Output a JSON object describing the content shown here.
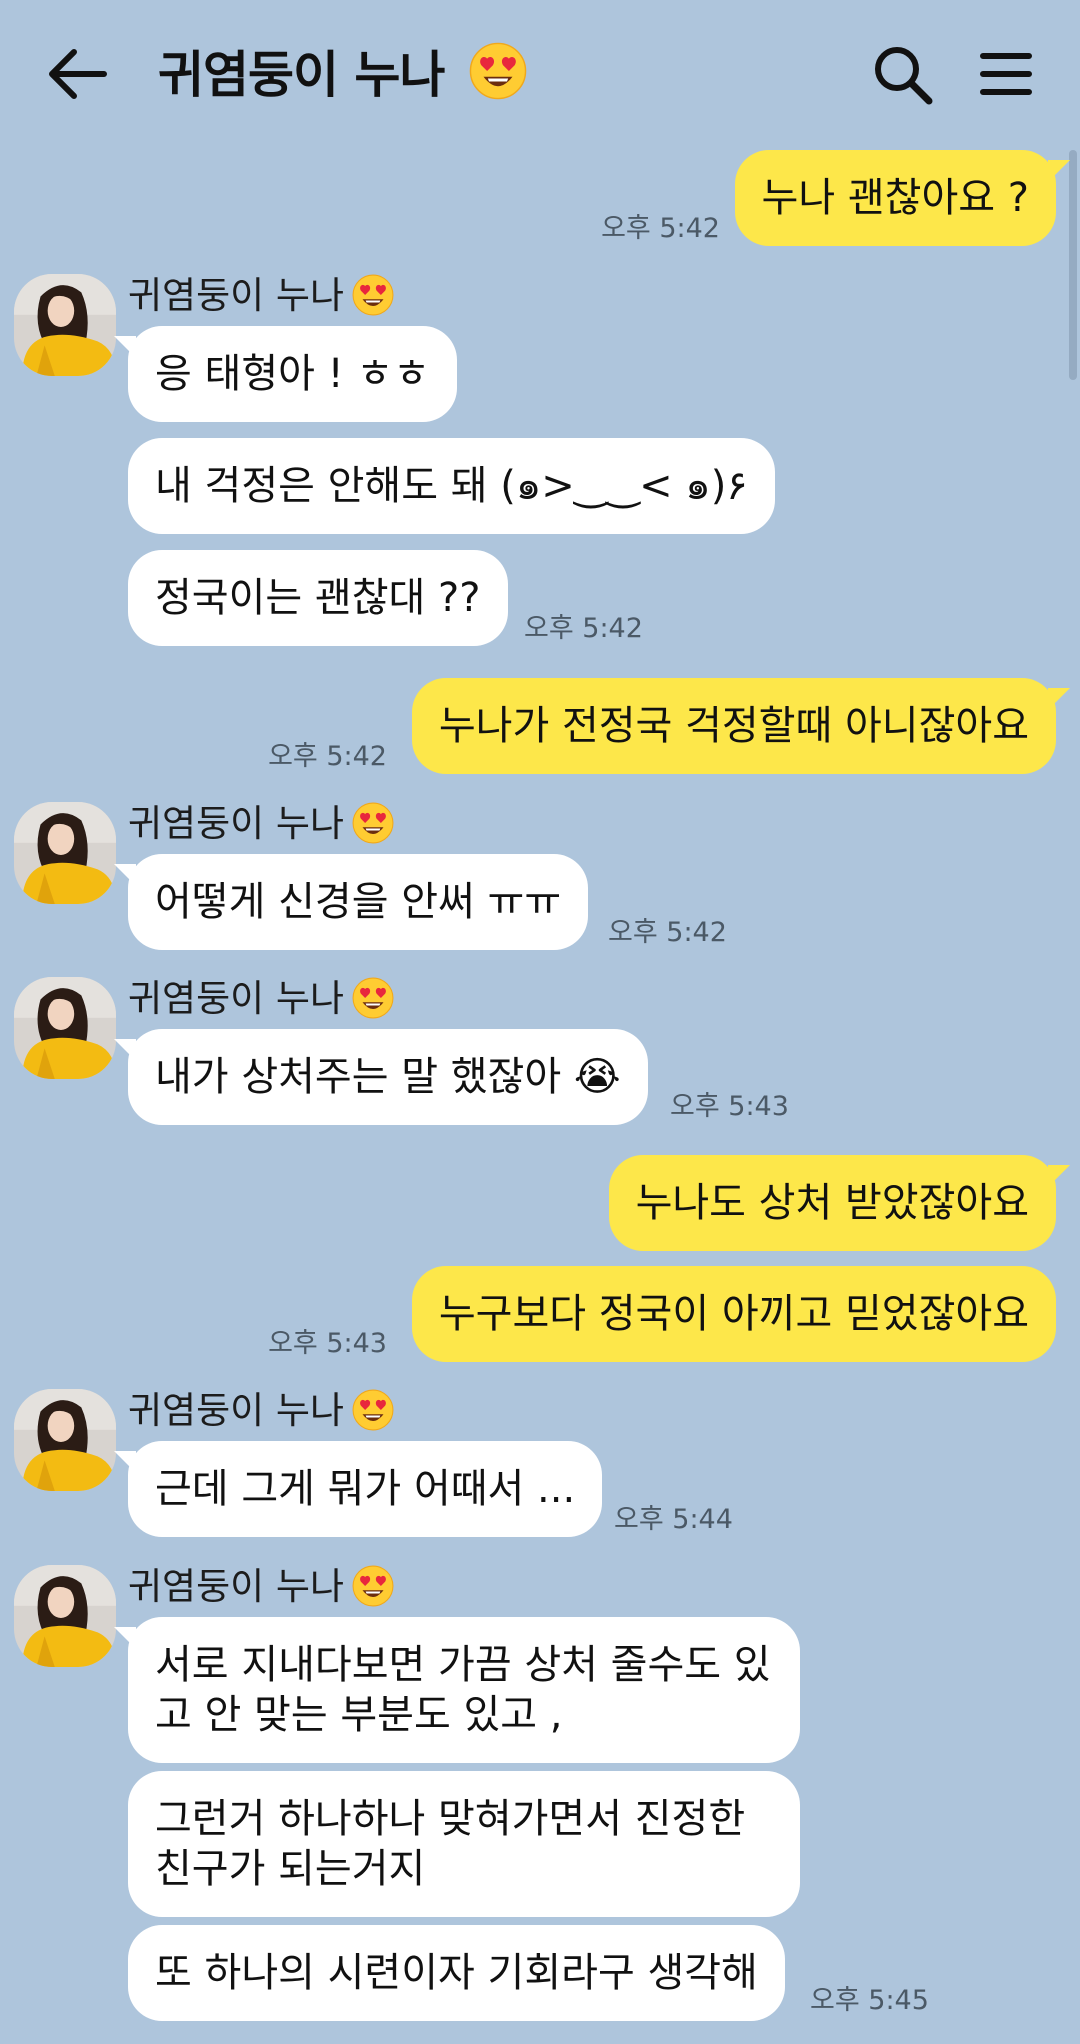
{
  "header": {
    "title": "귀염둥이 누나"
  },
  "messages": [
    {
      "text": "누나 괜찮아요 ?",
      "time": "오후 5:42"
    },
    {
      "sender": "귀염둥이 누나",
      "text": "응 태형아 ! ㅎㅎ"
    },
    {
      "text": "내 걱정은 안해도 돼 (๑>‿‿< ๑)۶"
    },
    {
      "text": "정국이는 괜찮대 ??",
      "time": "오후 5:42"
    },
    {
      "text": "누나가 전정국 걱정할때 아니잖아요",
      "time": "오후 5:42"
    },
    {
      "sender": "귀염둥이 누나",
      "text": "어떻게 신경을 안써 ㅠㅠ",
      "time": "오후 5:42"
    },
    {
      "sender": "귀염둥이 누나",
      "text": "내가 상처주는 말 했잖아 😭",
      "time": "오후 5:43"
    },
    {
      "text": "누나도 상처 받았잖아요"
    },
    {
      "text": "누구보다 정국이 아끼고 믿었잖아요",
      "time": "오후 5:43"
    },
    {
      "sender": "귀염둥이 누나",
      "text": "근데 그게 뭐가 어때서 ...",
      "time": "오후 5:44"
    },
    {
      "sender": "귀염둥이 누나",
      "text": "서로 지내다보면 가끔 상처 줄수도 있고 안 맞는 부분도 있고 ,"
    },
    {
      "text": "그런거 하나하나 맞혀가면서 진정한 친구가 되는거지"
    },
    {
      "text": "또 하나의 시련이자 기회라구 생각해",
      "time": "오후 5:45"
    }
  ],
  "colors": {
    "background": "#aec5dc",
    "outgoing_bubble": "#fde74a",
    "incoming_bubble": "#ffffff",
    "time_text": "#4b5966"
  },
  "icons": [
    "back-arrow-icon",
    "heart-eyes-emoji-icon",
    "search-icon",
    "menu-icon",
    "avatar"
  ]
}
